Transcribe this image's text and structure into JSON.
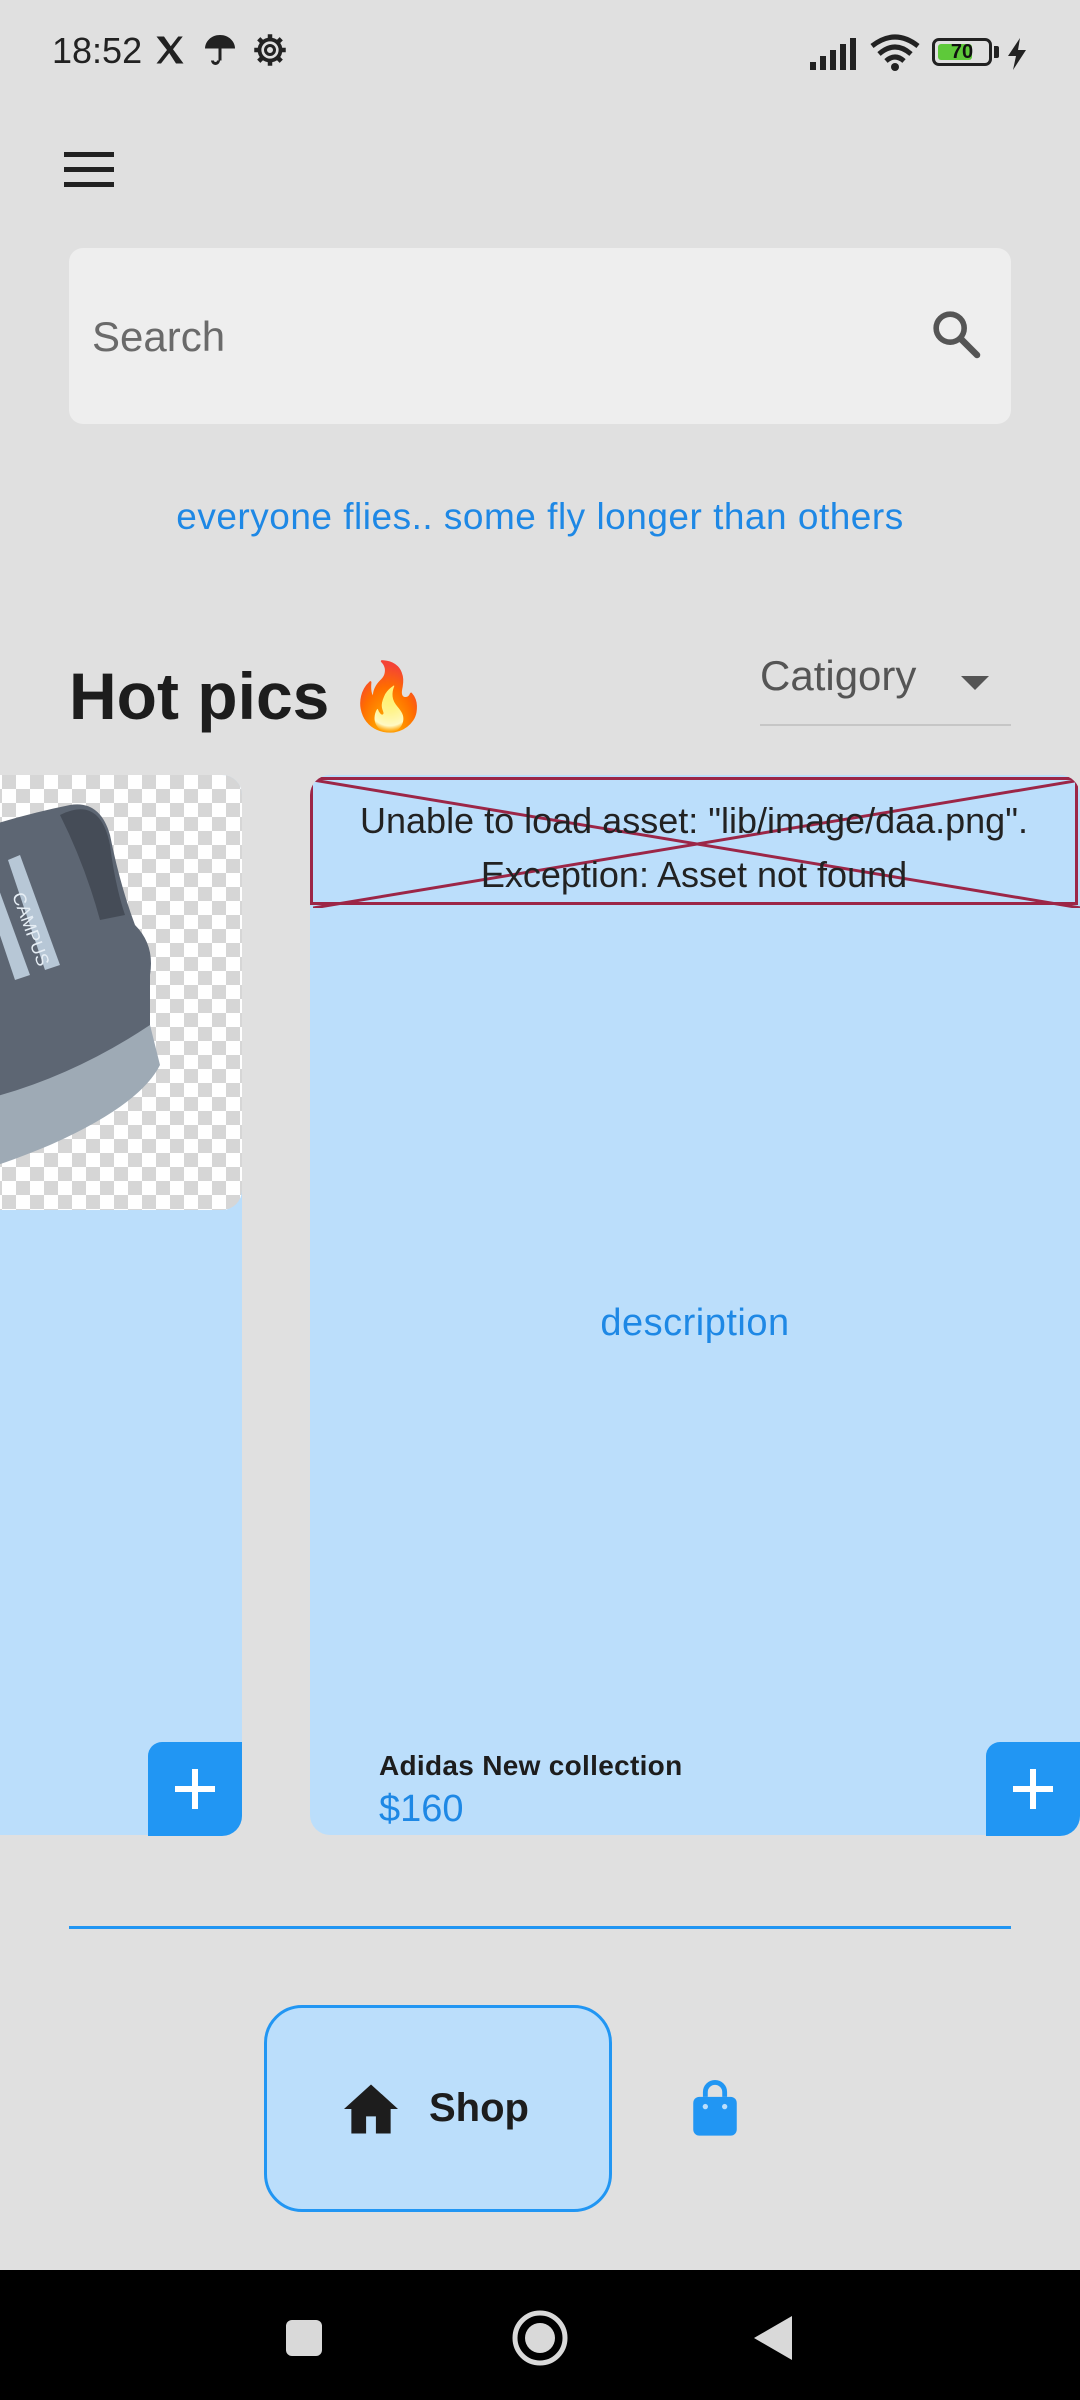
{
  "status_bar": {
    "time": "18:52",
    "icons": [
      "x-logo-icon",
      "umbrella-icon",
      "settings-gear-icon",
      "signal-icon",
      "wifi-icon",
      "battery-icon",
      "charging-bolt-icon"
    ],
    "battery_level": "70",
    "battery_fraction": 0.7
  },
  "header": {
    "menu_icon": "hamburger-menu-icon"
  },
  "search": {
    "placeholder": "Search",
    "icon": "search-icon"
  },
  "tagline": "everyone flies.. some fly longer than others",
  "section": {
    "title": "Hot pics 🔥",
    "category_dropdown": {
      "selected": "Catigory",
      "icon": "caret-down-icon"
    }
  },
  "products": [
    {
      "image": "sneaker-photo",
      "add_label_icon": "plus-icon"
    },
    {
      "image_error": "Unable to load asset: \"lib/image/daa.png\".\nException: Asset not found",
      "description": "description",
      "name": "Adidas New collection",
      "price": "$160",
      "add_label_icon": "plus-icon"
    }
  ],
  "bottom_nav": {
    "items": [
      {
        "label": "Shop",
        "icon": "home-icon",
        "active": true
      },
      {
        "label": "",
        "icon": "shopping-bag-icon",
        "active": false
      }
    ]
  },
  "system_nav": {
    "buttons": [
      "recents-square-icon",
      "home-circle-icon",
      "back-triangle-icon"
    ]
  },
  "colors": {
    "background": "#e0e0e0",
    "accent": "#2196f3",
    "card": "#bbdefb",
    "error_border": "#9c2647"
  }
}
